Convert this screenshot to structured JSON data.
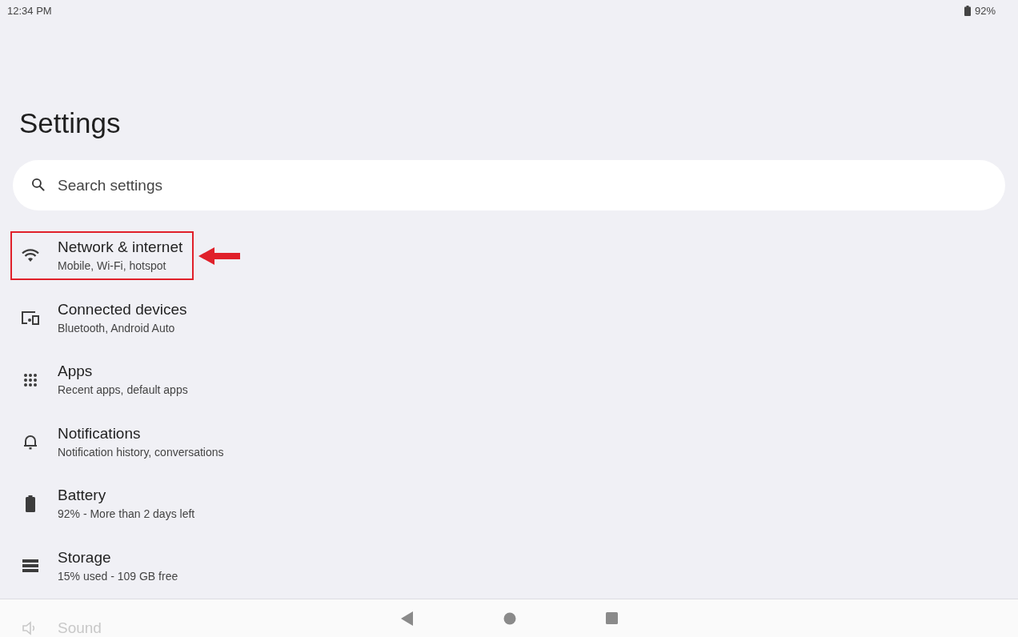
{
  "status_bar": {
    "time": "12:34 PM",
    "battery": "92%"
  },
  "title": "Settings",
  "search": {
    "placeholder": "Search settings"
  },
  "items": [
    {
      "title": "Network & internet",
      "subtitle": "Mobile, Wi-Fi, hotspot",
      "highlighted": true
    },
    {
      "title": "Connected devices",
      "subtitle": "Bluetooth, Android Auto",
      "highlighted": false
    },
    {
      "title": "Apps",
      "subtitle": "Recent apps, default apps",
      "highlighted": false
    },
    {
      "title": "Notifications",
      "subtitle": "Notification history, conversations",
      "highlighted": false
    },
    {
      "title": "Battery",
      "subtitle": "92% - More than 2 days left",
      "highlighted": false
    },
    {
      "title": "Storage",
      "subtitle": "15% used - 109 GB free",
      "highlighted": false
    },
    {
      "title": "Sound",
      "highlighted": false
    }
  ]
}
